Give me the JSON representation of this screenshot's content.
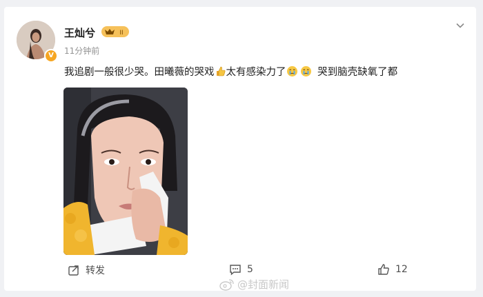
{
  "post": {
    "author": "王灿兮",
    "vip_badge": "II",
    "verified_badge": "V",
    "time": "11分钟前",
    "text_part1": "我追剧一般很少哭。田曦薇的哭戏",
    "text_part2": "太有感染力了",
    "text_part3": "哭到脑壳缺氧了都",
    "emojis": [
      "thumbs-up-emoji",
      "crying-emoji",
      "crying-emoji"
    ]
  },
  "actions": {
    "repost_label": "转发",
    "comment_count": "5",
    "like_count": "12"
  },
  "watermark": {
    "text": "@封面新闻"
  },
  "colors": {
    "accent": "#f6a623",
    "text": "#1f1f1f",
    "meta": "#939393"
  }
}
